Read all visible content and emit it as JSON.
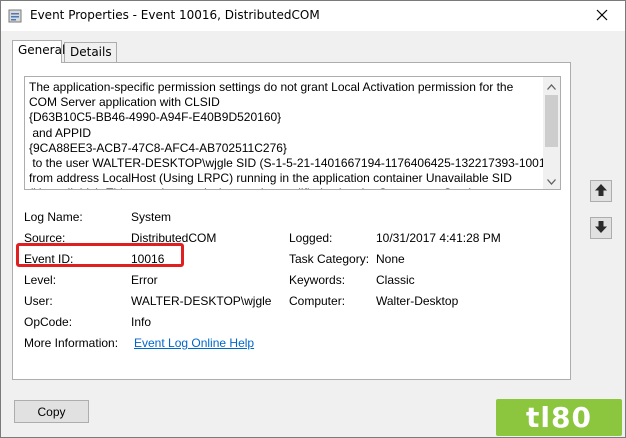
{
  "window": {
    "title": "Event Properties - Event 10016, DistributedCOM"
  },
  "tabs": [
    {
      "label": "General",
      "active": true
    },
    {
      "label": "Details",
      "active": false
    }
  ],
  "description": {
    "text": "The application-specific permission settings do not grant Local Activation permission for the\nCOM Server application with CLSID\n{D63B10C5-BB46-4990-A94F-E40B9D520160}\n and APPID\n{9CA88EE3-ACB7-47C8-AFC4-AB702511C276}\n to the user WALTER-DESKTOP\\wjgle SID (S-1-5-21-1401667194-1176406425-132217393-1001)\nfrom address LocalHost (Using LRPC) running in the application container Unavailable SID\n(Unavailable). This security permission can be modified using the Component Services"
  },
  "fields": {
    "log_name_label": "Log Name:",
    "log_name_value": "System",
    "source_label": "Source:",
    "source_value": "DistributedCOM",
    "logged_label": "Logged:",
    "logged_value": "10/31/2017 4:41:28 PM",
    "event_id_label": "Event ID:",
    "event_id_value": "10016",
    "task_category_label": "Task Category:",
    "task_category_value": "None",
    "level_label": "Level:",
    "level_value": "Error",
    "keywords_label": "Keywords:",
    "keywords_value": "Classic",
    "user_label": "User:",
    "user_value": "WALTER-DESKTOP\\wjgle",
    "computer_label": "Computer:",
    "computer_value": "Walter-Desktop",
    "opcode_label": "OpCode:",
    "opcode_value": "Info",
    "more_info_label": "More Information:",
    "more_info_link": "Event Log Online Help"
  },
  "buttons": {
    "copy": "Copy"
  },
  "watermark": {
    "text": "tl80"
  },
  "colors": {
    "highlight": "#e02020",
    "link": "#0066cc",
    "watermark_bg": "#8cc63f"
  },
  "icons": {
    "app": "event-viewer-icon",
    "close": "close-icon",
    "previous": "arrow-up-icon",
    "next": "arrow-down-icon"
  }
}
